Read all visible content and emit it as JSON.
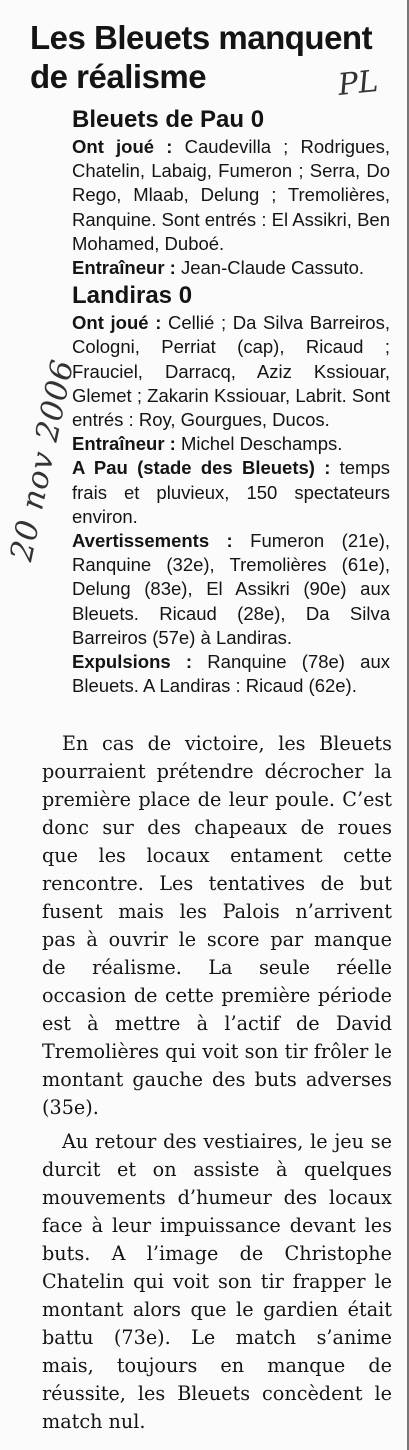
{
  "headline": "Les Bleuets manquent de réalisme",
  "annotations": {
    "initials": "PL",
    "date": "20 nov 2006"
  },
  "team1": {
    "title": "Bleuets de Pau 0",
    "played_label": "Ont joué :",
    "played_text": " Caudevilla ; Rodrigues, Chatelin, Labaig, Fumeron ; Serra, Do Rego, Mlaab, Delung ; Tremolières, Ranquine. Sont entrés : El Assikri, Ben Mohamed, Duboé.",
    "coach_label": "Entraîneur :",
    "coach_text": " Jean-Claude Cassuto."
  },
  "team2": {
    "title": "Landiras 0",
    "played_label": "Ont joué :",
    "played_text": " Cellié ; Da Silva Barreiros, Cologni, Perriat (cap), Ricaud ; Frauciel, Darracq, Aziz Kssiouar, Glemet ; Zakarin Kssiouar, Labrit. Sont entrés : Roy, Gourgues, Ducos.",
    "coach_label": "Entraîneur :",
    "coach_text": " Michel Deschamps."
  },
  "venue": {
    "label": "A Pau (stade des Bleuets) :",
    "text": " temps frais et pluvieux, 150 spectateurs environ."
  },
  "warnings": {
    "label": "Avertissements :",
    "text": " Fumeron (21e), Ranquine (32e), Tremolières (61e), Delung (83e), El Assikri (90e) aux Bleuets. Ricaud (28e), Da Silva Barreiros (57e) à Landiras."
  },
  "expulsions": {
    "label": "Expulsions :",
    "text": " Ranquine (78e) aux Bleuets. A Landiras : Ricaud (62e)."
  },
  "body": {
    "p1": "En cas de victoire, les Bleuets pourraient prétendre décrocher la première place de leur poule. C’est donc sur des chapeaux de roues que les locaux entament cette rencontre. Les tentatives de but fusent mais les Palois n’arrivent pas à ouvrir le score par manque de réalisme. La seule réelle occasion de cette première période est à mettre à l’actif de David Tremolières qui voit son tir frôler le montant gauche des buts adverses (35e).",
    "p2": "Au retour des vestiaires, le jeu se durcit et on assiste à quelques mouvements d’humeur des locaux face à leur impuissance devant les buts. A l’image de Christophe Chatelin qui voit son tir frapper le montant alors que le gardien était battu (73e). Le match s’anime mais, toujours en manque de réussite, les Bleuets concèdent le match nul."
  }
}
